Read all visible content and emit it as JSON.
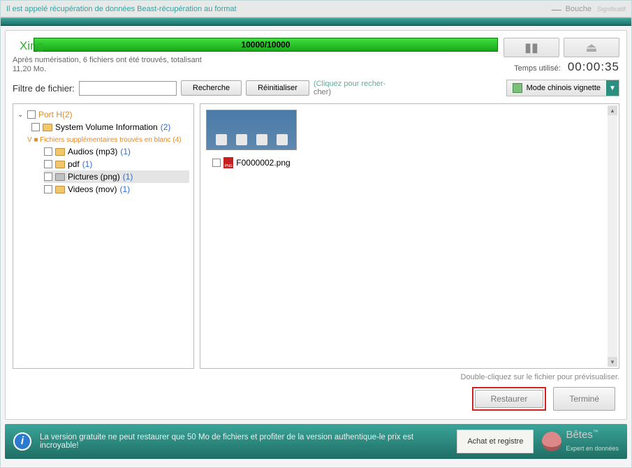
{
  "titlebar": {
    "title": "Il est appelé récupération de données Beast-récupération au format",
    "btn2": "Bouche",
    "btn3": "Significatif"
  },
  "progress": {
    "xing": "Xing",
    "counter": "10000/10000",
    "status_line1": "Après numérisation, 6 fichiers ont été trouvés, totalisant",
    "status_line2": "11,20 Mo."
  },
  "time": {
    "label": "Temps utilisé:",
    "value": "00:00:35"
  },
  "filter": {
    "label": "Filtre de fichier:",
    "search": "Recherche",
    "reset": "Réinitialiser",
    "hint_top": "(Cliquez pour recher-",
    "hint_bot": "cher)"
  },
  "viewmode": {
    "label": "Mode chinois vignette",
    "arrow": "▼"
  },
  "tree": {
    "root": "Port H(2)",
    "node1_name": "System Volume Information",
    "node1_count": "(2)",
    "sup_label": "V ■ Fichiers supplémentaires trouvés en blanc (4)",
    "audios": "Audios (mp3)",
    "audios_c": "(1)",
    "pdf": "pdf",
    "pdf_c": "(1)",
    "pics": "Pictures (png)",
    "pics_c": "(1)",
    "vids": "Videos (mov)",
    "vids_c": "(1)"
  },
  "files": {
    "item1": "F0000002.png"
  },
  "preview_hint": "Double-cliquez sur le fichier pour prévisualiser.",
  "buttons": {
    "restore": "Restaurer",
    "finish": "Terminé"
  },
  "footer": {
    "text": "La version gratuite ne peut restaurer que 50 Mo de fichiers et profiter de la version authentique-le prix est incroyable!",
    "buy": "Achat et registre",
    "brand": "Bêtes",
    "brand_sub": "Expert en données"
  }
}
